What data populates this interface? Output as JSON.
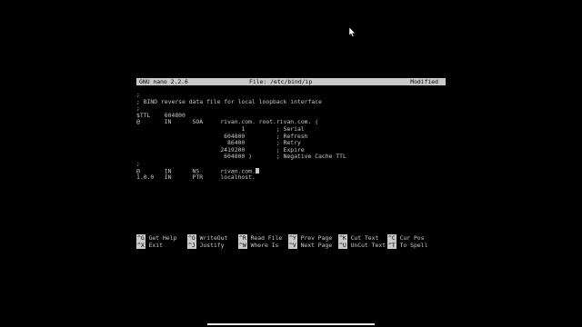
{
  "title_bar": {
    "app": "GNU nano 2.2.6",
    "file": "File: /etc/bind/ip",
    "status": "Modified"
  },
  "buffer": {
    "lines": [
      ";",
      "; BIND reverse data file for local loopback interface",
      ";",
      "$TTL    604800",
      "@       IN      SOA     rivan.com. root.rivan.com. (",
      "                              1         ; Serial",
      "                         604800         ; Refresh",
      "                          86400         ; Retry",
      "                        2419200         ; Expire",
      "                         604800 )       ; Negative Cache TTL",
      ";",
      "@       IN      NS      rivan.com.",
      "1.0.0   IN      PTR     localhost."
    ]
  },
  "shortcuts": {
    "row1": [
      {
        "key": "^G",
        "label": "Get Help"
      },
      {
        "key": "^O",
        "label": "WriteOut"
      },
      {
        "key": "^R",
        "label": "Read File"
      },
      {
        "key": "^Y",
        "label": "Prev Page"
      },
      {
        "key": "^K",
        "label": "Cut Text"
      },
      {
        "key": "^C",
        "label": "Cur Pos"
      }
    ],
    "row2": [
      {
        "key": "^X",
        "label": "Exit"
      },
      {
        "key": "^J",
        "label": "Justify"
      },
      {
        "key": "^W",
        "label": "Where Is"
      },
      {
        "key": "^V",
        "label": "Next Page"
      },
      {
        "key": "^U",
        "label": "UnCut Text"
      },
      {
        "key": "^T",
        "label": "To Spell"
      }
    ]
  },
  "colors": {
    "background": "#000000",
    "text": "#c9c9c9",
    "inverse_bg": "#c9c9c9"
  }
}
